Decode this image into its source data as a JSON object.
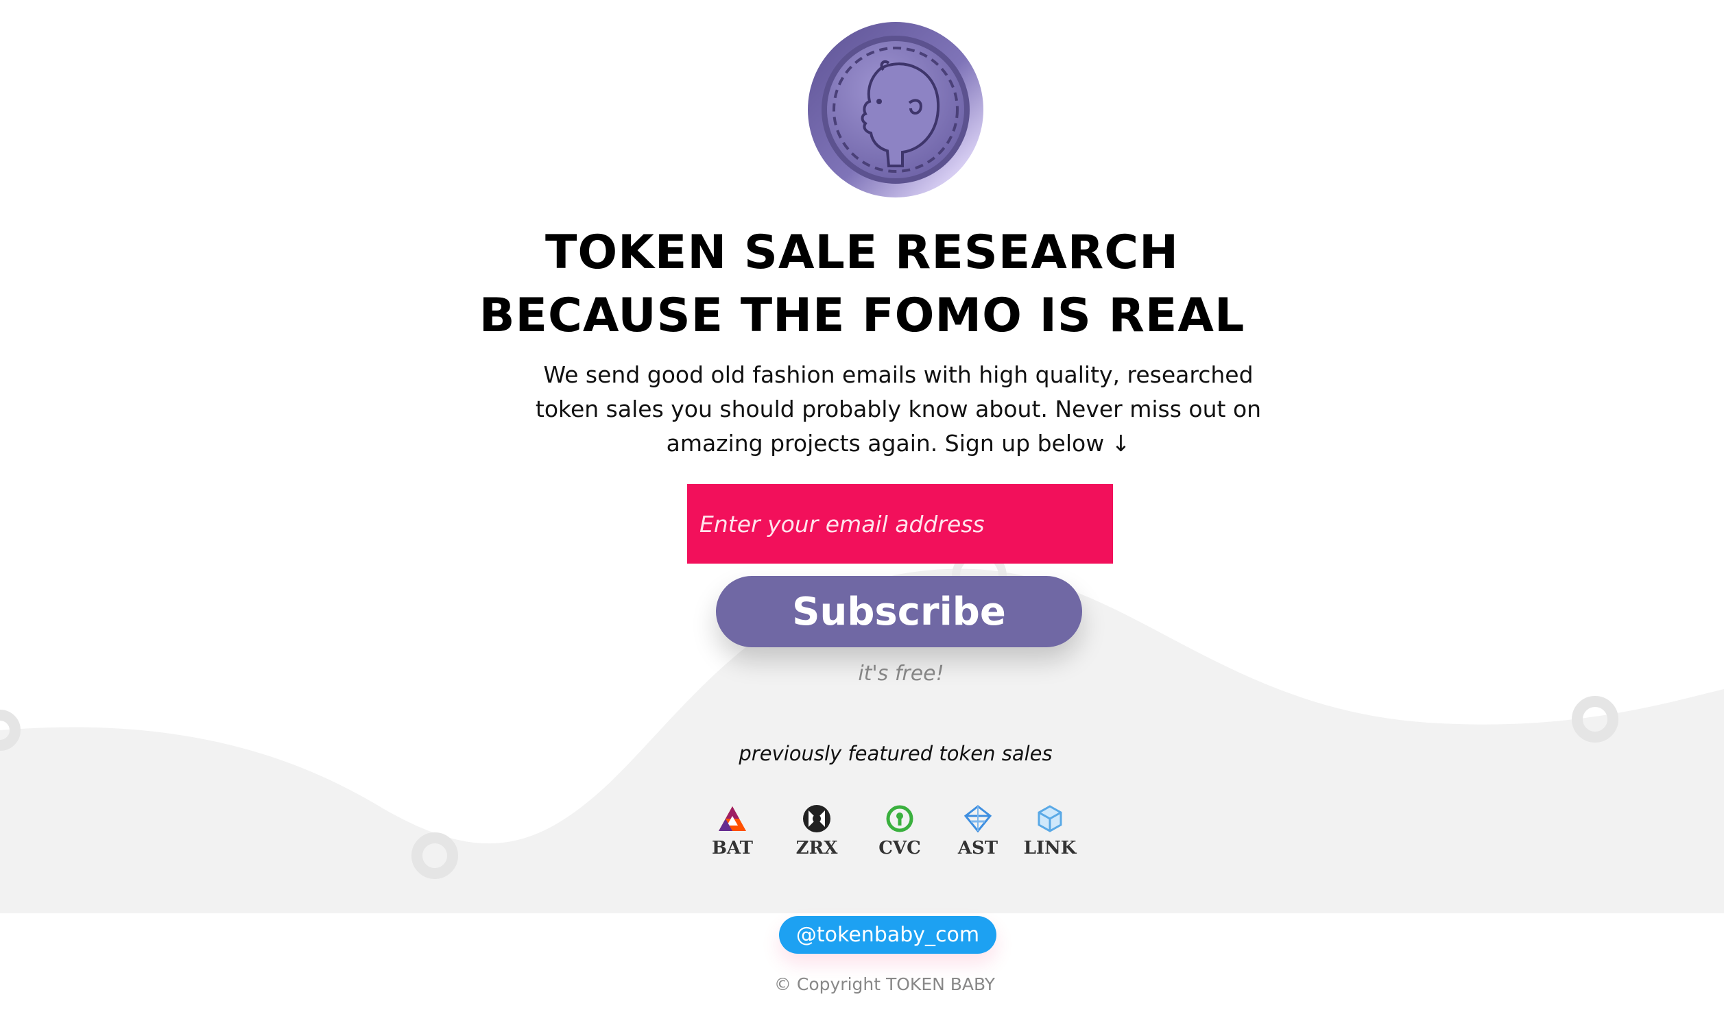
{
  "logo": {
    "icon": "baby-coin-icon",
    "colors": {
      "outer": "#6a5f9e",
      "inner": "#8b80c2",
      "highlight": "#d6cdf2"
    }
  },
  "hero": {
    "headline_line1": "TOKEN SALE RESEARCH",
    "headline_line2": "BECAUSE THE FOMO IS REAL",
    "intro": "We send good old fashion emails with high quality, researched token sales you should probably know about. Never miss out on amazing projects again. Sign up below ↓"
  },
  "signup": {
    "email_placeholder": "Enter your email address",
    "email_value": "",
    "subscribe_label": "Subscribe",
    "free_note": "it's free!",
    "colors": {
      "input_bg": "#f2105b",
      "button_bg": "#7068a4"
    }
  },
  "featured": {
    "title": "previously featured token sales",
    "tokens": [
      {
        "label": "BAT",
        "icon": "bat-icon"
      },
      {
        "label": "ZRX",
        "icon": "zrx-icon"
      },
      {
        "label": "CVC",
        "icon": "cvc-icon"
      },
      {
        "label": "AST",
        "icon": "ast-icon"
      },
      {
        "label": "LINK",
        "icon": "link-icon"
      }
    ]
  },
  "footer": {
    "twitter_handle": "@tokenbaby_com",
    "copyright": "© Copyright TOKEN BABY",
    "colors": {
      "twitter_bg": "#1da1f2"
    }
  }
}
